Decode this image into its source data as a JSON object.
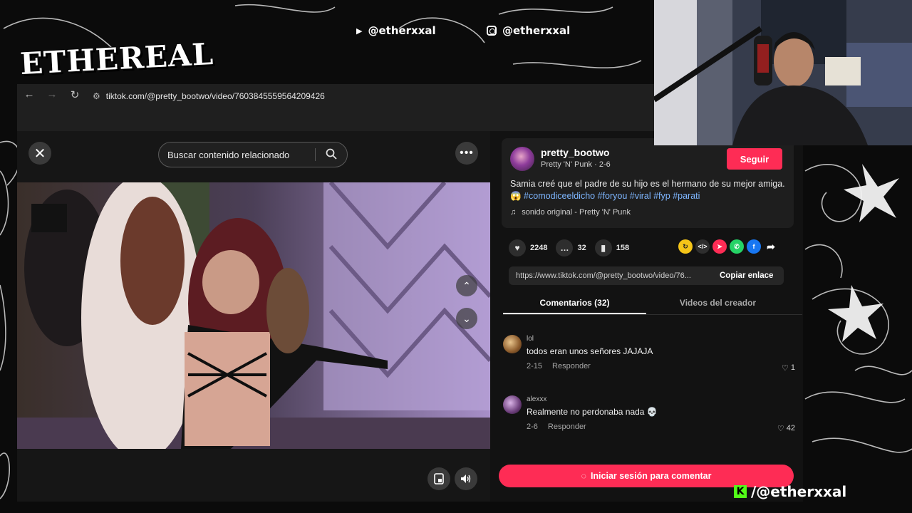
{
  "overlay": {
    "logo": "ETHEREAL",
    "youtube_handle": "@etherxxal",
    "instagram_handle": "@etherxxal",
    "kick_handle": "/@etherxxal",
    "kick_letter": "K"
  },
  "browser": {
    "back": "←",
    "forward": "→",
    "reload": "↻",
    "url": "tiktok.com/@pretty_bootwo/video/7603845559564209426"
  },
  "video": {
    "close": "✕",
    "search_placeholder": "Buscar contenido relacionado",
    "more": "•••",
    "up": "⌃",
    "down": "⌄"
  },
  "post": {
    "username": "pretty_bootwo",
    "subtitle": "Pretty 'N' Punk · 2-6",
    "follow": "Seguir",
    "description": "Samia creé que el padre de su hijo es el hermano de su mejor amiga.😱 ",
    "hashtags": "#comodiceeldicho #foryou #viral #fyp #parati",
    "music_note": "♫",
    "music": "sonido original - Pretty 'N' Punk",
    "likes": "2248",
    "comments": "32",
    "saves": "158",
    "link": "https://www.tiktok.com/@pretty_bootwo/video/76...",
    "copy_link": "Copiar enlace"
  },
  "tabs": {
    "comments": "Comentarios (32)",
    "creator_videos": "Videos del creador"
  },
  "comments": [
    {
      "user": "lol",
      "text": "todos eran unos señores JAJAJA",
      "date": "2-15",
      "reply": "Responder",
      "likes": "1"
    },
    {
      "user": "alexxx",
      "text": "Realmente no perdonaba nada 💀",
      "date": "2-6",
      "reply": "Responder",
      "likes": "42"
    }
  ],
  "login_button": "Iniciar sesión para comentar",
  "colors": {
    "accent": "#fe2c55",
    "hashtag": "#7eb6ff",
    "kick": "#53fc18"
  }
}
